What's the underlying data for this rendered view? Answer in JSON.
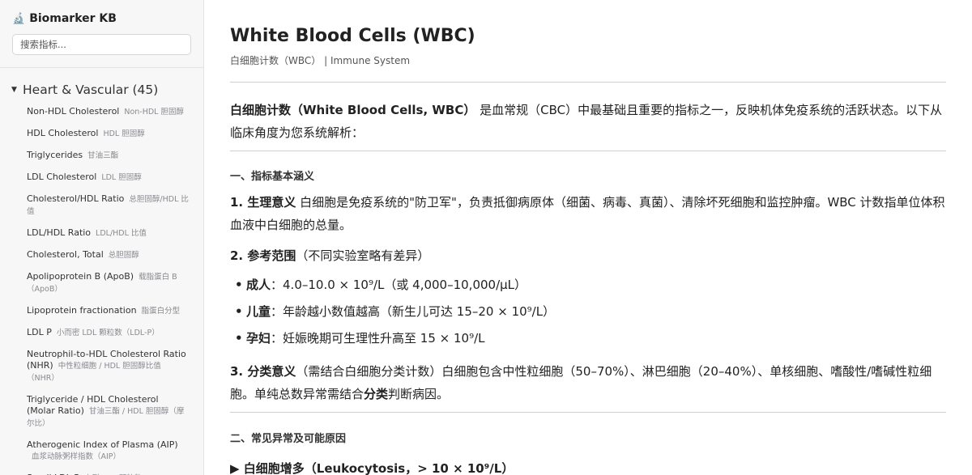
{
  "sidebar": {
    "brand_icon": "microscope-icon",
    "brand_glyph": "🔬",
    "brand_title": "Biomarker KB",
    "search_placeholder": "搜索指标...",
    "category": {
      "label": "Heart & Vascular (45)",
      "caret": "▼"
    },
    "items": [
      {
        "en": "Non-HDL Cholesterol",
        "cn": "Non-HDL 胆固醇"
      },
      {
        "en": "HDL Cholesterol",
        "cn": "HDL 胆固醇"
      },
      {
        "en": "Triglycerides",
        "cn": "甘油三酯"
      },
      {
        "en": "LDL Cholesterol",
        "cn": "LDL 胆固醇"
      },
      {
        "en": "Cholesterol/HDL Ratio",
        "cn": "总胆固醇/HDL 比值"
      },
      {
        "en": "LDL/HDL Ratio",
        "cn": "LDL/HDL 比值"
      },
      {
        "en": "Cholesterol, Total",
        "cn": "总胆固醇"
      },
      {
        "en": "Apolipoprotein B (ApoB)",
        "cn": "载脂蛋白 B（ApoB）"
      },
      {
        "en": "Lipoprotein fractionation",
        "cn": "脂蛋白分型"
      },
      {
        "en": "LDL P",
        "cn": "小而密 LDL 颗粒数（LDL-P）"
      },
      {
        "en": "Neutrophil-to-HDL Cholesterol Ratio (NHR)",
        "cn": "中性粒细胞 / HDL 胆固醇比值（NHR）"
      },
      {
        "en": "Triglyceride / HDL Cholesterol (Molar Ratio)",
        "cn": "甘油三酯 / HDL 胆固醇（摩尔比）"
      },
      {
        "en": "Atherogenic Index of Plasma (AIP)",
        "cn": "血浆动脉粥样指数（AIP）"
      },
      {
        "en": "Small LDL P",
        "cn": "小型 LDL 颗粒数"
      }
    ]
  },
  "main": {
    "title": "White Blood Cells (WBC)",
    "subtitle": "白细胞计数（WBC） | Immune System",
    "intro_bold": "白细胞计数（White Blood Cells, WBC）",
    "intro_rest": "是血常规（CBC）中最基础且重要的指标之一，反映机体免疫系统的活跃状态。以下从临床角度为您系统解析：",
    "section1": "一、指标基本涵义",
    "p1_bold": "1. 生理意义",
    "p1_rest": "白细胞是免疫系统的\"防卫军\"，负责抵御病原体（细菌、病毒、真菌）、清除坏死细胞和监控肿瘤。WBC 计数指单位体积血液中白细胞的总量。",
    "p2_bold": "2. 参考范围",
    "p2_rest": "（不同实验室略有差异）",
    "bullets": [
      {
        "label": "成人",
        "text": "：4.0–10.0 × 10⁹/L（或 4,000–10,000/μL）"
      },
      {
        "label": "儿童",
        "text": "：年龄越小数值越高（新生儿可达 15–20 × 10⁹/L）"
      },
      {
        "label": "孕妇",
        "text": "：妊娠晚期可生理性升高至 15 × 10⁹/L"
      }
    ],
    "p3_bold": "3. 分类意义",
    "p3_mid": "（需结合白细胞分类计数）白细胞包含中性粒细胞（50–70%）、淋巴细胞（20–40%）、单核细胞、嗜酸性/嗜碱性粒细胞。单纯总数异常需结合",
    "p3_bold2": "分类",
    "p3_end": "判断病因。",
    "section2": "二、常见异常及可能原因",
    "sub_heading": "▶ 白细胞增多（Leukocytosis，> 10 × 10⁹/L）"
  }
}
